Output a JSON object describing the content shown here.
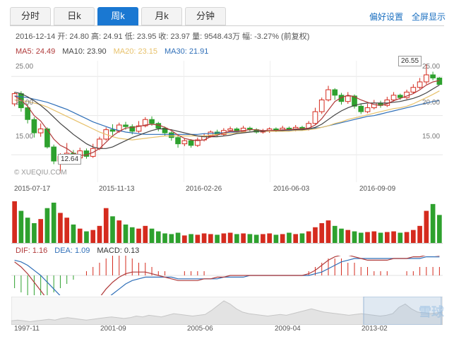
{
  "tabs": [
    {
      "label": "分时"
    },
    {
      "label": "日k"
    },
    {
      "label": "周k"
    },
    {
      "label": "月k"
    },
    {
      "label": "分钟"
    }
  ],
  "toolbar": {
    "prefs": "偏好设置",
    "fullscreen": "全屏显示"
  },
  "info": {
    "text": "2016-12-14 开: 24.80 高: 24.91 低: 23.95 收: 23.97 量: 9548.43万 幅: -3.27% (前复权)"
  },
  "ma": {
    "ma5": "MA5: 24.49",
    "ma10": "MA10: 23.90",
    "ma20": "MA20: 23.15",
    "ma30": "MA30: 21.91"
  },
  "colors": {
    "ma5": "#b03a3a",
    "ma10": "#444444",
    "ma20": "#e7c16a",
    "ma30": "#2f6fb8",
    "up": "#d52b1e",
    "down": "#2ea12e"
  },
  "y_axis": {
    "left": [
      "25.00",
      "20.00",
      "15.00"
    ],
    "right": [
      "25.00",
      "20.00",
      "15.00"
    ]
  },
  "x_axis": [
    "2015-07-17",
    "2015-11-13",
    "2016-02-26",
    "2016-06-03",
    "2016-09-09"
  ],
  "callouts": {
    "high": "26.55",
    "low": "12.64"
  },
  "watermark": "© XUEQIU.COM",
  "macd": {
    "dif": "DIF: 1.16",
    "dea": "DEA: 1.09",
    "macd": "MACD: 0.13"
  },
  "nav_axis": [
    "1997-11",
    "2001-09",
    "2005-06",
    "2009-04",
    "2013-02"
  ],
  "logo": "雪球",
  "chart_data": {
    "type": "candlestick",
    "ylim": [
      11.5,
      27
    ],
    "candles": [
      [
        21.5,
        22.8,
        23.0,
        21.2
      ],
      [
        22.8,
        21.0,
        23.1,
        20.5
      ],
      [
        21.0,
        19.5,
        21.5,
        19.0
      ],
      [
        19.5,
        17.8,
        19.8,
        17.2
      ],
      [
        17.8,
        18.3,
        19.0,
        17.3
      ],
      [
        18.3,
        16.0,
        18.5,
        15.8
      ],
      [
        16.0,
        14.2,
        16.3,
        13.8
      ],
      [
        14.2,
        14.8,
        15.2,
        12.64
      ],
      [
        14.8,
        15.2,
        16.5,
        14.3
      ],
      [
        15.2,
        14.6,
        15.6,
        14.3
      ],
      [
        14.6,
        15.5,
        15.9,
        14.4
      ],
      [
        15.5,
        14.8,
        15.8,
        14.5
      ],
      [
        14.8,
        15.8,
        16.4,
        14.6
      ],
      [
        15.8,
        17.0,
        17.3,
        15.6
      ],
      [
        17.0,
        18.2,
        18.5,
        16.8
      ],
      [
        18.2,
        18.0,
        18.9,
        17.5
      ],
      [
        18.0,
        18.8,
        19.1,
        17.8
      ],
      [
        18.8,
        18.6,
        19.2,
        18.2
      ],
      [
        18.6,
        18.0,
        18.9,
        17.6
      ],
      [
        18.0,
        18.7,
        19.3,
        17.8
      ],
      [
        18.7,
        19.5,
        19.8,
        18.5
      ],
      [
        19.5,
        19.0,
        19.9,
        18.7
      ],
      [
        19.0,
        18.4,
        19.2,
        18.0
      ],
      [
        18.4,
        17.8,
        18.6,
        17.4
      ],
      [
        17.8,
        17.2,
        18.0,
        16.8
      ],
      [
        17.2,
        16.4,
        17.4,
        15.9
      ],
      [
        16.4,
        16.8,
        17.1,
        16.1
      ],
      [
        16.8,
        16.2,
        17.0,
        15.9
      ],
      [
        16.2,
        16.9,
        17.2,
        16.0
      ],
      [
        16.9,
        17.4,
        17.7,
        16.7
      ],
      [
        17.4,
        17.9,
        18.1,
        17.2
      ],
      [
        17.9,
        17.6,
        18.2,
        17.3
      ],
      [
        17.6,
        18.1,
        18.4,
        17.4
      ],
      [
        18.1,
        18.3,
        18.6,
        17.9
      ],
      [
        18.3,
        18.0,
        18.5,
        17.8
      ],
      [
        18.0,
        18.4,
        18.7,
        17.8
      ],
      [
        18.4,
        18.2,
        18.6,
        18.0
      ],
      [
        18.2,
        17.9,
        18.4,
        17.7
      ],
      [
        17.9,
        18.0,
        18.3,
        17.7
      ],
      [
        18.0,
        18.3,
        18.5,
        17.8
      ],
      [
        18.3,
        18.1,
        18.5,
        17.9
      ],
      [
        18.1,
        18.4,
        18.7,
        18.0
      ],
      [
        18.4,
        18.2,
        18.6,
        18.0
      ],
      [
        18.2,
        18.5,
        18.8,
        18.0
      ],
      [
        18.5,
        18.3,
        18.7,
        18.1
      ],
      [
        18.3,
        19.0,
        19.3,
        18.1
      ],
      [
        19.0,
        20.5,
        21.0,
        18.9
      ],
      [
        20.5,
        22.0,
        22.3,
        20.2
      ],
      [
        22.0,
        23.3,
        23.8,
        21.8
      ],
      [
        23.3,
        22.6,
        23.5,
        22.0
      ],
      [
        22.6,
        21.8,
        22.9,
        21.4
      ],
      [
        21.8,
        22.5,
        23.0,
        21.5
      ],
      [
        22.5,
        21.2,
        22.7,
        20.9
      ],
      [
        21.2,
        20.5,
        21.5,
        20.2
      ],
      [
        20.5,
        21.0,
        21.5,
        20.3
      ],
      [
        21.0,
        21.6,
        22.0,
        20.8
      ],
      [
        21.6,
        21.3,
        21.9,
        21.0
      ],
      [
        21.3,
        22.0,
        22.4,
        21.1
      ],
      [
        22.0,
        22.6,
        23.0,
        21.8
      ],
      [
        22.6,
        22.3,
        22.8,
        22.0
      ],
      [
        22.3,
        23.0,
        23.3,
        22.1
      ],
      [
        23.0,
        23.6,
        24.0,
        22.8
      ],
      [
        23.6,
        24.3,
        24.8,
        23.4
      ],
      [
        24.3,
        25.2,
        26.55,
        24.0
      ],
      [
        25.2,
        24.8,
        25.6,
        24.5
      ],
      [
        24.8,
        23.97,
        24.91,
        23.95
      ]
    ],
    "ma5": [
      22.5,
      22.0,
      21.2,
      20.0,
      19.3,
      18.2,
      17.0,
      16.2,
      15.8,
      15.2,
      14.9,
      15.0,
      15.3,
      15.8,
      16.6,
      17.4,
      18.0,
      18.4,
      18.5,
      18.6,
      18.8,
      18.9,
      18.8,
      18.5,
      18.1,
      17.5,
      17.1,
      16.9,
      16.8,
      16.9,
      17.3,
      17.5,
      17.8,
      18.0,
      18.0,
      18.1,
      18.2,
      18.2,
      18.1,
      18.1,
      18.1,
      18.2,
      18.2,
      18.3,
      18.3,
      18.4,
      18.8,
      19.6,
      20.7,
      21.8,
      22.3,
      22.6,
      22.4,
      22.0,
      21.7,
      21.4,
      21.3,
      21.5,
      21.9,
      22.2,
      22.5,
      22.8,
      23.3,
      23.9,
      24.3,
      24.49
    ],
    "ma10": [
      23.0,
      22.8,
      22.4,
      21.9,
      21.3,
      20.6,
      19.8,
      19.0,
      18.3,
      17.6,
      17.0,
      16.4,
      16.0,
      15.8,
      15.8,
      16.0,
      16.4,
      16.8,
      17.2,
      17.5,
      17.8,
      18.1,
      18.3,
      18.3,
      18.2,
      18.0,
      17.8,
      17.6,
      17.4,
      17.3,
      17.3,
      17.3,
      17.4,
      17.5,
      17.7,
      17.8,
      17.9,
      18.0,
      18.0,
      18.1,
      18.1,
      18.1,
      18.2,
      18.2,
      18.2,
      18.3,
      18.5,
      18.9,
      19.5,
      20.1,
      20.6,
      21.0,
      21.3,
      21.5,
      21.6,
      21.6,
      21.6,
      21.6,
      21.7,
      21.8,
      22.0,
      22.2,
      22.5,
      22.9,
      23.4,
      23.9
    ],
    "ma20": [
      22.0,
      21.9,
      21.8,
      21.6,
      21.4,
      21.1,
      20.7,
      20.3,
      19.9,
      19.5,
      19.1,
      18.7,
      18.3,
      17.9,
      17.6,
      17.3,
      17.1,
      17.0,
      16.9,
      17.0,
      17.1,
      17.2,
      17.3,
      17.4,
      17.4,
      17.4,
      17.4,
      17.4,
      17.4,
      17.4,
      17.5,
      17.6,
      17.7,
      17.7,
      17.8,
      17.9,
      17.9,
      18.0,
      18.0,
      18.0,
      18.0,
      18.0,
      18.0,
      18.1,
      18.1,
      18.2,
      18.3,
      18.5,
      18.7,
      19.0,
      19.2,
      19.5,
      19.7,
      19.9,
      20.1,
      20.3,
      20.5,
      20.7,
      20.9,
      21.0,
      21.2,
      21.5,
      21.9,
      22.3,
      22.7,
      23.15
    ],
    "ma30": [
      22.5,
      22.4,
      22.3,
      22.1,
      21.9,
      21.7,
      21.4,
      21.1,
      20.8,
      20.4,
      20.0,
      19.6,
      19.2,
      18.9,
      18.6,
      18.3,
      18.1,
      17.9,
      17.8,
      17.7,
      17.6,
      17.6,
      17.6,
      17.6,
      17.6,
      17.6,
      17.6,
      17.6,
      17.6,
      17.7,
      17.7,
      17.8,
      17.8,
      17.9,
      17.9,
      17.9,
      17.9,
      18.0,
      18.0,
      18.0,
      18.0,
      18.1,
      18.1,
      18.2,
      18.2,
      18.3,
      18.4,
      18.5,
      18.7,
      18.9,
      19.1,
      19.3,
      19.5,
      19.7,
      19.9,
      20.0,
      20.2,
      20.4,
      20.6,
      20.8,
      21.0,
      21.2,
      21.4,
      21.6,
      21.8,
      21.91
    ],
    "volume": [
      62,
      48,
      38,
      30,
      36,
      52,
      60,
      45,
      38,
      28,
      22,
      18,
      20,
      26,
      52,
      40,
      34,
      28,
      24,
      22,
      26,
      22,
      18,
      15,
      14,
      16,
      12,
      14,
      13,
      15,
      14,
      13,
      15,
      16,
      14,
      15,
      14,
      13,
      14,
      15,
      13,
      14,
      16,
      14,
      15,
      18,
      24,
      30,
      34,
      26,
      22,
      20,
      18,
      16,
      17,
      18,
      16,
      17,
      18,
      16,
      17,
      20,
      26,
      48,
      58,
      42
    ],
    "macd_bar": [
      -3,
      -4,
      -5,
      -6,
      -6,
      -5,
      -4,
      -3,
      -2,
      -1,
      0,
      1,
      2,
      3,
      4,
      5,
      5,
      5,
      4,
      3,
      3,
      2,
      1,
      1,
      0,
      0,
      1,
      1,
      1,
      1,
      0,
      0,
      0,
      0,
      0,
      0,
      0,
      0,
      0,
      0,
      0,
      0,
      0,
      0,
      0,
      1,
      2,
      3,
      4,
      4,
      4,
      3,
      3,
      2,
      2,
      1,
      1,
      1,
      0,
      0,
      1,
      1,
      2,
      2,
      2,
      2
    ],
    "dif": [
      0.8,
      0.5,
      0.1,
      -0.4,
      -0.9,
      -1.4,
      -1.9,
      -2.3,
      -2.5,
      -2.6,
      -2.5,
      -2.2,
      -1.8,
      -1.3,
      -0.8,
      -0.4,
      -0.1,
      0.1,
      0.2,
      0.2,
      0.2,
      0.1,
      0.0,
      -0.1,
      -0.2,
      -0.3,
      -0.3,
      -0.3,
      -0.3,
      -0.2,
      -0.2,
      -0.1,
      -0.1,
      0.0,
      0.0,
      0.0,
      0.0,
      0.0,
      0.0,
      0.0,
      0.0,
      0.0,
      0.0,
      0.0,
      0.0,
      0.1,
      0.3,
      0.6,
      0.9,
      1.1,
      1.2,
      1.2,
      1.1,
      1.0,
      0.9,
      0.9,
      0.9,
      0.9,
      1.0,
      1.0,
      1.0,
      1.1,
      1.1,
      1.2,
      1.2,
      1.16
    ],
    "dea": [
      0.9,
      0.8,
      0.6,
      0.3,
      0.0,
      -0.4,
      -0.8,
      -1.2,
      -1.5,
      -1.8,
      -2.0,
      -2.0,
      -1.9,
      -1.7,
      -1.4,
      -1.1,
      -0.8,
      -0.5,
      -0.3,
      -0.2,
      -0.1,
      -0.1,
      -0.1,
      -0.1,
      -0.1,
      -0.2,
      -0.2,
      -0.2,
      -0.2,
      -0.2,
      -0.2,
      -0.2,
      -0.1,
      -0.1,
      -0.1,
      -0.1,
      0.0,
      0.0,
      0.0,
      0.0,
      0.0,
      0.0,
      0.0,
      0.0,
      0.0,
      0.0,
      0.1,
      0.2,
      0.4,
      0.6,
      0.8,
      0.9,
      1.0,
      1.0,
      1.0,
      1.0,
      1.0,
      1.0,
      1.0,
      1.0,
      1.0,
      1.0,
      1.0,
      1.1,
      1.1,
      1.09
    ],
    "nav_series": [
      5,
      6,
      5,
      4,
      5,
      6,
      7,
      6,
      8,
      9,
      8,
      7,
      6,
      7,
      8,
      9,
      10,
      9,
      8,
      9,
      11,
      10,
      12,
      11,
      10,
      12,
      14,
      13,
      12,
      11,
      12,
      13,
      18,
      24,
      30,
      26,
      20,
      16,
      14,
      13,
      12,
      11,
      12,
      13,
      12,
      14,
      16,
      18,
      20,
      18,
      16,
      15,
      14,
      13,
      12,
      13,
      14,
      13,
      12,
      11,
      12,
      14,
      22,
      26,
      20,
      16,
      15,
      14,
      15,
      16
    ]
  }
}
